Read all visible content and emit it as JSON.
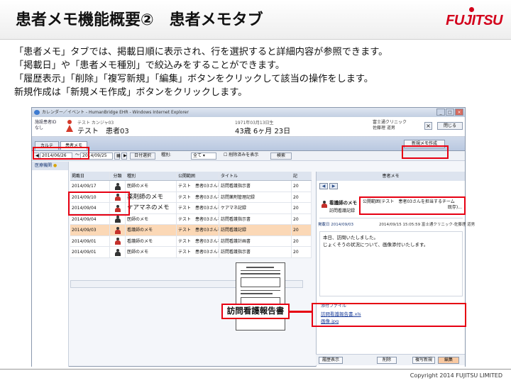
{
  "slide": {
    "title": "患者メモ機能概要②　患者メモタブ",
    "logo": "FUJITSU",
    "intro": [
      "「患者メモ」タブでは、掲載日順に表示され、行を選択すると詳細内容が参照できます。",
      "「掲載日」や「患者メモ種別」で絞込みをすることができます。",
      "「履歴表示」「削除」「複写新規」「編集」ボタンをクリックして該当の操作をします。",
      "新規作成は「新規メモ作成」ボタンをクリックします。"
    ],
    "copyright": "Copyright 2014 FUJITSU LIMITED",
    "callout_label": "訪問看護報告書"
  },
  "window": {
    "title": "カレンダー／イベント - HumanBridge EHR - Windows Internet Explorer",
    "patient": {
      "id_label": "施設患者ID",
      "id_value": "なし",
      "kana": "テスト カンジャ03",
      "name": "テスト　患者03",
      "birth": "1971年03月13日生",
      "age": "43歳 6ヶ月 23日",
      "clinic": "富士通クリニック",
      "doctor": "佐藤理 道男",
      "close_x": "×",
      "close": "閉じる"
    },
    "tabs": [
      {
        "label": "カルテ"
      },
      {
        "label": "患者メモ"
      }
    ],
    "new_memo": "新規メモ作成",
    "filter": {
      "date_from": "2014/06/26",
      "sep": "～",
      "date_to": "2014/09/25",
      "date_select": "日付選択",
      "type_label": "種別:",
      "type_value": "全て",
      "show_deleted": "削除済みを表示",
      "search": "検索"
    },
    "sidebar": {
      "label": "医療機関"
    },
    "table": {
      "headers": [
        "掲載日",
        "分類",
        "種別",
        "公開範囲",
        "タイトル",
        "記"
      ],
      "rows": [
        {
          "date": "2014/09/17",
          "type": "医師のメモ",
          "scope": "テスト　患者03さんを",
          "title": "訪問看護指示書",
          "last": "20"
        },
        {
          "date": "2014/09/10",
          "type": "薬剤師のメモ",
          "scope": "テスト　患者03さんを",
          "title": "訪問薬剤管理記録",
          "last": "20"
        },
        {
          "date": "2014/09/04",
          "type": "ケアマネのメモ",
          "scope": "テスト　患者03さんを",
          "title": "ケアマネ記録",
          "last": "20"
        },
        {
          "date": "2014/09/04",
          "type": "医師のメモ",
          "scope": "テスト　患者03さんを",
          "title": "訪問看護指示書",
          "last": "20"
        },
        {
          "date": "2014/09/03",
          "type": "看護師のメモ",
          "scope": "テスト　患者03さんを",
          "title": "訪問看護記録",
          "last": "20"
        },
        {
          "date": "2014/09/01",
          "type": "看護師のメモ",
          "scope": "テスト　患者03さんを",
          "title": "訪問看護計画書",
          "last": "20"
        },
        {
          "date": "2014/09/01",
          "type": "医師のメモ",
          "scope": "テスト　患者03さんを",
          "title": "訪問看護指示書",
          "last": "20"
        }
      ]
    },
    "panel": {
      "header": "患者メモ",
      "nav_prev": "◀",
      "nav_next": "▶",
      "memo_type": "看護師のメモ",
      "memo_title": "訪問看護記録",
      "scope": "公開範囲(テスト　患者03さんを担当するチーム",
      "scope_tail": "既存)...",
      "posted_label": "掲載日 2014/09/03",
      "updated": "2014/09/15 15:05:59  富士通クリニック-佐藤理 道男",
      "body_line1": "本日、訪問いたしました。",
      "body_line2": "じょくそうの状況について、画像添付いたします。",
      "attach_label": "添付ファイル",
      "files": [
        "訪問看護報告書.xls",
        "画像.jpg"
      ]
    },
    "buttons": {
      "history": "履歴表示",
      "delete": "削除",
      "copy_new": "複写新規",
      "edit": "編集"
    }
  },
  "colors": {
    "accent_red": "#e60012",
    "selected_row": "#fbd8b6",
    "link": "#1a3d9a"
  }
}
